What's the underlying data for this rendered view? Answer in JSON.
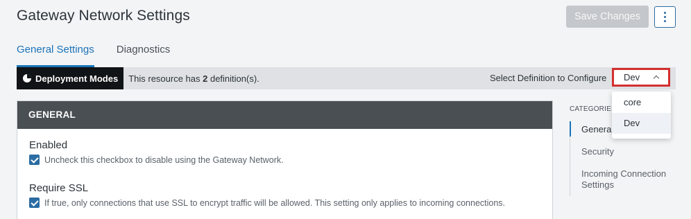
{
  "header": {
    "title": "Gateway Network Settings",
    "save_label": "Save Changes"
  },
  "tabs": [
    {
      "label": "General Settings",
      "active": true
    },
    {
      "label": "Diagnostics",
      "active": false
    }
  ],
  "definition_bar": {
    "badge_label": "Deployment Modes",
    "text_prefix": "This resource has ",
    "count": "2",
    "text_suffix": " definition(s).",
    "select_label": "Select Definition to Configure",
    "selected": "Dev",
    "options": [
      "core",
      "Dev"
    ]
  },
  "panel": {
    "heading": "GENERAL",
    "settings": [
      {
        "title": "Enabled",
        "checked": true,
        "description": "Uncheck this checkbox to disable using the Gateway Network."
      },
      {
        "title": "Require SSL",
        "checked": true,
        "description": "If true, only connections that use SSL to encrypt traffic will be allowed. This setting only applies to incoming connections."
      }
    ]
  },
  "categories": {
    "label": "CATEGORIES",
    "items": [
      {
        "label": "General",
        "active": true
      },
      {
        "label": "Security",
        "active": false
      },
      {
        "label": "Incoming Connection Settings",
        "active": false
      }
    ]
  },
  "colors": {
    "accent": "#1a73b8",
    "highlight_border": "#d32f2f"
  }
}
